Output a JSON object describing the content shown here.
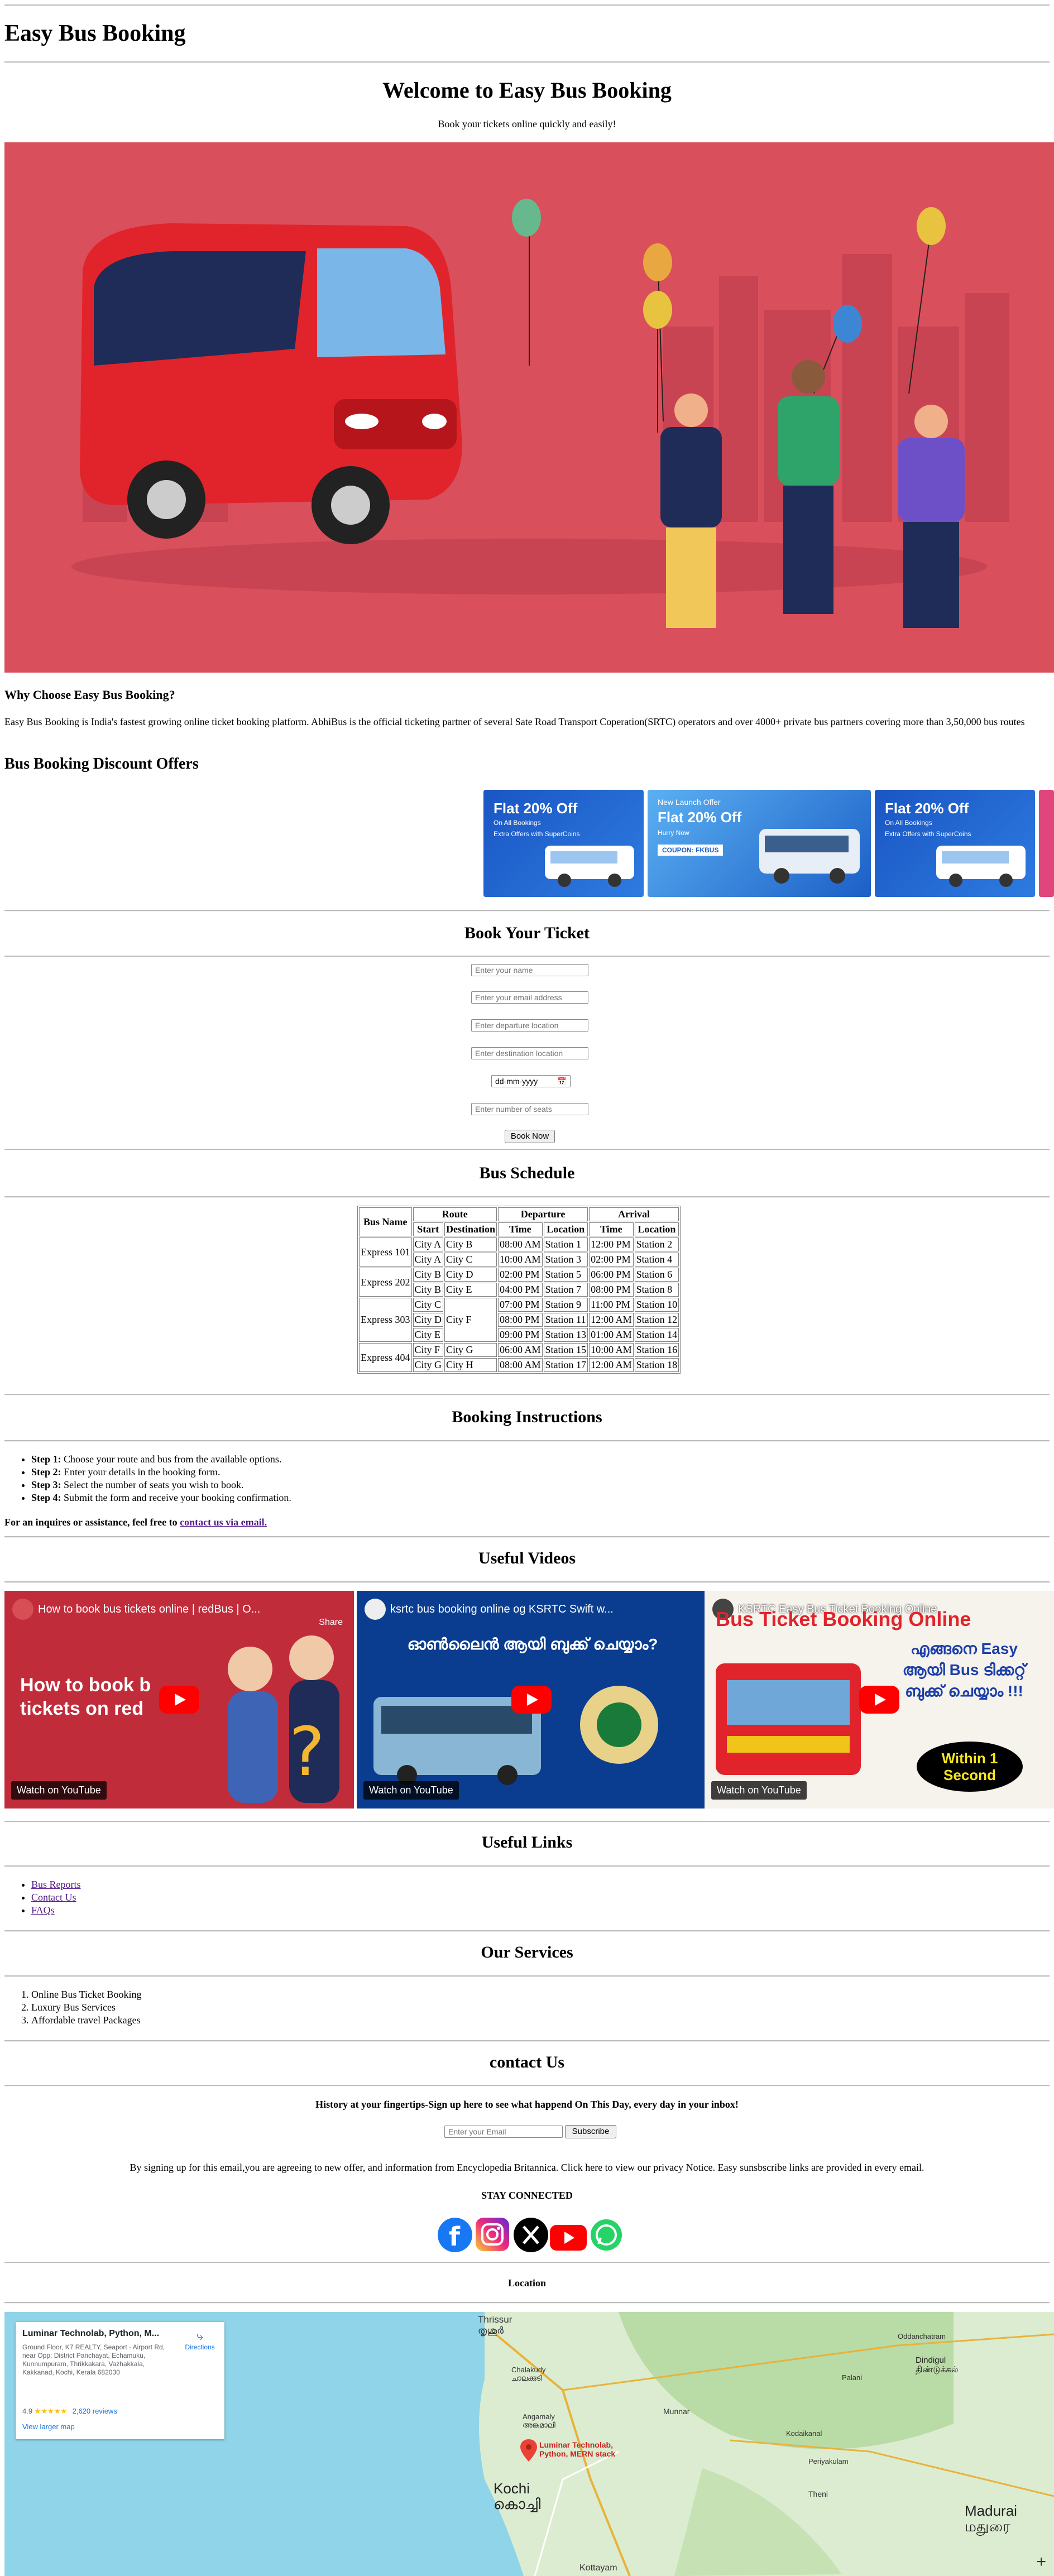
{
  "header": {
    "title": "Easy Bus Booking"
  },
  "hero": {
    "heading": "Welcome to Easy Bus Booking",
    "subheading": "Book your tickets online quickly and easily!"
  },
  "why": {
    "title": "Why Choose Easy Bus Booking?",
    "text": "Easy Bus Booking is India's fastest growing online ticket booking platform. AbhiBus is the official ticketing partner of several Sate Road Transport Coperation(SRTC) operators and over 4000+ private bus partners covering more than 3,50,000 bus routes"
  },
  "offers": {
    "title": "Bus Booking Discount Offers",
    "cards": [
      {
        "headline": "Flat 20% Off",
        "line1": "On All Bookings",
        "line2": "Extra Offers with SuperCoins"
      },
      {
        "headline": "Flat 20% Off",
        "tag": "New Launch Offer",
        "line1": "Hurry Now",
        "line2": "COUPON: FKBUS"
      },
      {
        "headline": "Flat 20% Off",
        "line1": "On All Bookings",
        "line2": "Extra Offers with SuperCoins"
      }
    ]
  },
  "booking": {
    "title": "Book Your Ticket",
    "name_placeholder": "Enter your name",
    "email_placeholder": "Enter your email address",
    "departure_placeholder": "Enter departure location",
    "destination_placeholder": "Enter destination location",
    "date_placeholder": "dd-mm-yyyy",
    "seats_placeholder": "Enter number of seats",
    "submit_label": "Book Now"
  },
  "schedule": {
    "title": "Bus Schedule",
    "headers": {
      "bus_name": "Bus Name",
      "route": "Route",
      "departure": "Departure",
      "arrival": "Arrival",
      "start": "Start",
      "destination": "Destination",
      "time": "Time",
      "location": "Location"
    },
    "rows": [
      [
        "Express 101",
        "City A",
        "City B",
        "08:00 AM",
        "Station 1",
        "12:00 PM",
        "Station 2"
      ],
      [
        "",
        "City A",
        "City C",
        "10:00 AM",
        "Station 3",
        "02:00 PM",
        "Station 4"
      ],
      [
        "Express 202",
        "City B",
        "City D",
        "02:00 PM",
        "Station 5",
        "06:00 PM",
        "Station 6"
      ],
      [
        "",
        "City B",
        "City E",
        "04:00 PM",
        "Station 7",
        "08:00 PM",
        "Station 8"
      ],
      [
        "Express 303",
        "City C",
        "City F",
        "07:00 PM",
        "Station 9",
        "11:00 PM",
        "Station 10"
      ],
      [
        "",
        "City D",
        "",
        "08:00 PM",
        "Station 11",
        "12:00 AM",
        "Station 12"
      ],
      [
        "",
        "City E",
        "",
        "09:00 PM",
        "Station 13",
        "01:00 AM",
        "Station 14"
      ],
      [
        "Express 404",
        "City F",
        "City G",
        "06:00 AM",
        "Station 15",
        "10:00 AM",
        "Station 16"
      ],
      [
        "",
        "City G",
        "City H",
        "08:00 AM",
        "Station 17",
        "12:00 AM",
        "Station 18"
      ]
    ]
  },
  "instructions": {
    "title": "Booking Instructions",
    "steps": [
      {
        "label": "Step 1:",
        "text": " Choose your route and bus from the available options."
      },
      {
        "label": "Step 2:",
        "text": " Enter your details in the booking form."
      },
      {
        "label": "Step 3:",
        "text": " Select the number of seats you wish to book."
      },
      {
        "label": "Step 4:",
        "text": " Submit the form and receive your booking confirmation."
      }
    ],
    "contact_prefix": "For an inquires or assistance, feel free to ",
    "contact_link": "contact us via email."
  },
  "videos": {
    "title": "Useful Videos",
    "items": [
      {
        "title": "How to book bus tickets online | redBus | O...",
        "share": "Share",
        "overlay": "How to book b\ntickets on red",
        "watch": "Watch on YouTube"
      },
      {
        "title": "ksrtc bus booking online og KSRTC Swift w...",
        "overlay": "ഓൺലൈൻ ആയി ബുക്ക് ചെയ്യാം?",
        "watch": "Watch on YouTube"
      },
      {
        "title": "KSRTC Easy Bus Ticket Booking Online",
        "overlay": "Bus Ticket Booking Online",
        "overlay2": "എങ്ങനെ Easy ആയി Bus ടിക്കറ്റ് ബുക്ക് ചെയ്യാം !!!",
        "badge": "Within 1 Second",
        "watch": "Watch on YouTube"
      }
    ]
  },
  "links": {
    "title": "Useful Links",
    "items": [
      "Bus Reports",
      "Contact Us",
      "FAQs"
    ]
  },
  "services": {
    "title": "Our Services",
    "items": [
      "Online Bus Ticket Booking",
      "Luxury Bus Services",
      "Affordable travel Packages"
    ]
  },
  "contact": {
    "title": "contact Us",
    "newsletter": "History at your fingertips-Sign up here to see what happend On This Day, every day in your inbox!",
    "email_placeholder": "Enter your Email",
    "subscribe_label": "Subscribe",
    "disclaimer": "By signing up for this email,you are agreeing to new offer, and information from Encyclopedia Britannica. Click here to view our privacy Notice. Easy sunsbscribe links are provided in every email.",
    "stay_connected": "STAY CONNECTED"
  },
  "location": {
    "title": "Location",
    "card": {
      "name": "Luminar Technolab, Python, M...",
      "address": "Ground Floor, K7 REALTY, Seaport - Airport Rd, near Opp: District Panchayat, Echamuku, Kunnumpuram, Thrikkakara, Vazhakkala, Kakkanad, Kochi, Kerala 682030",
      "rating": "4.9",
      "reviews": "2,620 reviews",
      "directions": "Directions",
      "larger_map": "View larger map"
    },
    "places": [
      "Thrissur\nതൃശൂർ",
      "Chalakudy\nചാലക്കുടി",
      "Angamaly\nഅങ്കമാലി",
      "Kochi\nകൊച്ചി",
      "Luminar Technolab,\nPython, MERN stack",
      "Madurai\nமதுரை",
      "Dindigul\nதிண்டுக்கல்",
      "Munnar",
      "Theni",
      "Kottayam",
      "Oddanchatram",
      "Palani",
      "Periyakulam",
      "Kodaikanal"
    ]
  },
  "colors": {
    "hero_bg": "#d94f5c",
    "bus_red": "#e1242b",
    "offer_blue": "#1c5fc7",
    "youtube_red": "#ff0000"
  }
}
